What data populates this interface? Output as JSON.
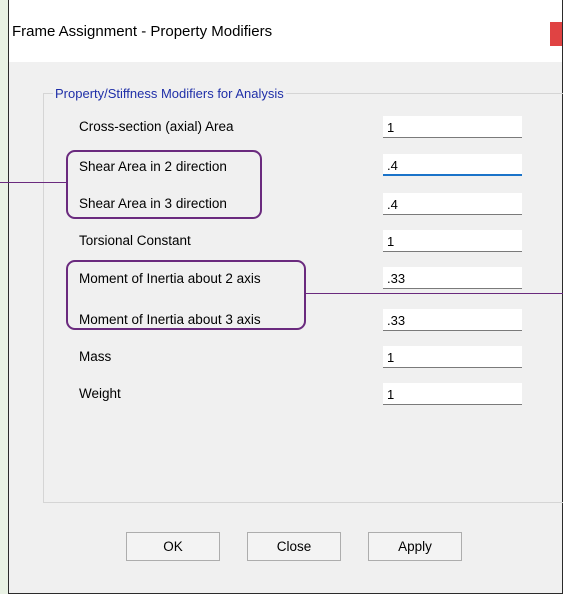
{
  "dialog": {
    "title": "Frame Assignment - Property Modifiers"
  },
  "group": {
    "legend": "Property/Stiffness Modifiers for Analysis"
  },
  "rows": [
    {
      "label": "Cross-section (axial) Area",
      "value": "1"
    },
    {
      "label": "Shear Area in 2 direction",
      "value": ".4"
    },
    {
      "label": "Shear Area in 3 direction",
      "value": ".4"
    },
    {
      "label": "Torsional Constant",
      "value": "1"
    },
    {
      "label": "Moment of Inertia about 2 axis",
      "value": ".33"
    },
    {
      "label": "Moment of Inertia about 3 axis",
      "value": ".33"
    },
    {
      "label": "Mass",
      "value": "1"
    },
    {
      "label": "Weight",
      "value": "1"
    }
  ],
  "buttons": {
    "ok": "OK",
    "close": "Close",
    "apply": "Apply"
  },
  "colors": {
    "highlight": "#6a2a7e",
    "legend_text": "#1f2fa8",
    "focus_underline": "#1a73c9",
    "close_button": "#e04343"
  }
}
